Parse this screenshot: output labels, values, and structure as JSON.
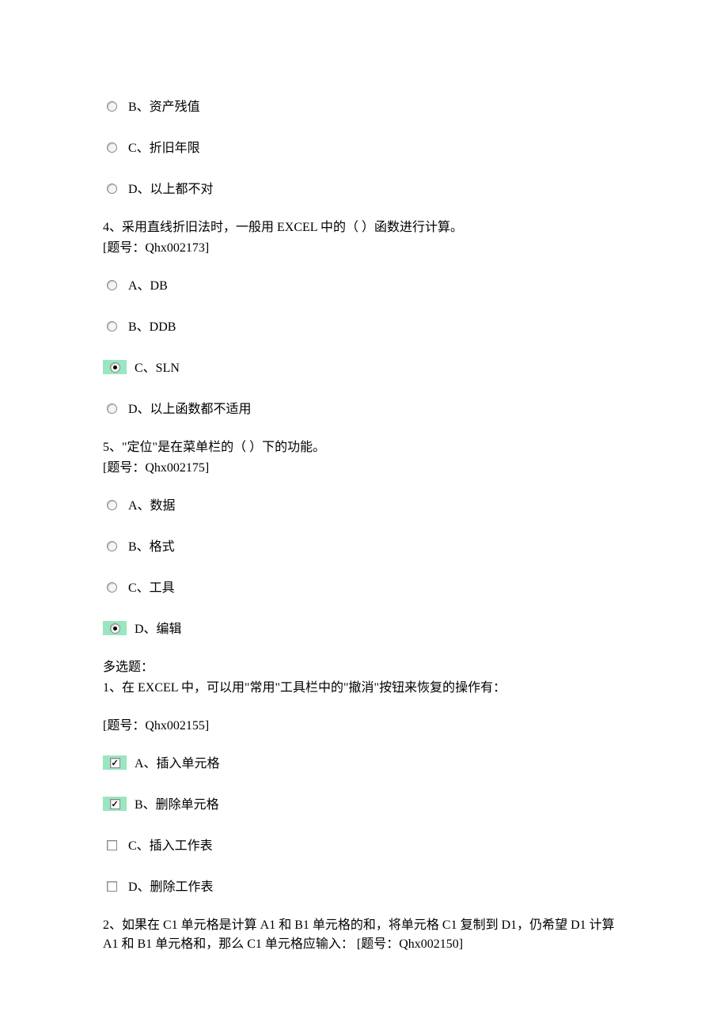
{
  "q3": {
    "options": {
      "b": "B、资产残值",
      "c": "C、折旧年限",
      "d": "D、以上都不对"
    }
  },
  "q4": {
    "text": "4、采用直线折旧法时，一般用 EXCEL 中的（ ）函数进行计算。",
    "id": "[题号：Qhx002173]",
    "options": {
      "a": "A、DB",
      "b": "B、DDB",
      "c": "C、SLN",
      "d": "D、以上函数都不适用"
    }
  },
  "q5": {
    "text": "5、\"定位\"是在菜单栏的（ ）下的功能。",
    "id": "[题号：Qhx002175]",
    "options": {
      "a": "A、数据",
      "b": "B、格式",
      "c": "C、工具",
      "d": "D、编辑"
    }
  },
  "multi": {
    "title": "多选题：",
    "q1": {
      "text": "1、在 EXCEL 中，可以用\"常用\"工具栏中的\"撤消\"按钮来恢复的操作有：",
      "id": "[题号：Qhx002155]",
      "options": {
        "a": "A、插入单元格",
        "b": "B、删除单元格",
        "c": "C、插入工作表",
        "d": "D、删除工作表"
      }
    },
    "q2": {
      "text": "2、如果在 C1 单元格是计算 A1 和 B1 单元格的和，将单元格 C1 复制到 D1，仍希望 D1 计算 A1 和 B1 单元格和，那么 C1 单元格应输入：  [题号：Qhx002150]"
    }
  }
}
